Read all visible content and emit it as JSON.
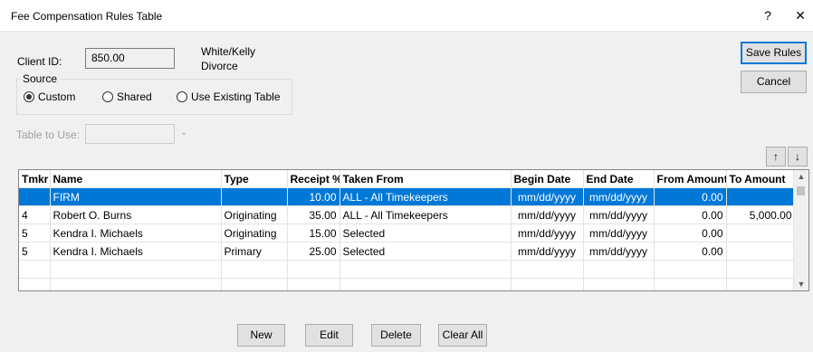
{
  "window": {
    "title": "Fee Compensation Rules Table",
    "help": "?",
    "close": "✕"
  },
  "client": {
    "id_label": "Client ID:",
    "id_value": "850.00",
    "name_line1": "White/Kelly",
    "name_line2": "Divorce"
  },
  "source": {
    "legend": "Source",
    "options": [
      {
        "label": "Custom",
        "selected": true
      },
      {
        "label": "Shared",
        "selected": false
      },
      {
        "label": "Use Existing Table",
        "selected": false
      }
    ]
  },
  "table_to_use": {
    "label": "Table to Use:",
    "value": ""
  },
  "actions": {
    "save_rules": "Save Rules",
    "cancel": "Cancel"
  },
  "move": {
    "up": "↑",
    "down": "↓"
  },
  "grid": {
    "columns": [
      "Tmkr",
      "Name",
      "Type",
      "Receipt %",
      "Taken From",
      "Begin Date",
      "End Date",
      "From Amount",
      "To Amount"
    ],
    "rows": [
      [
        "",
        "FIRM",
        "",
        "10.00",
        "ALL - All Timekeepers",
        "mm/dd/yyyy",
        "mm/dd/yyyy",
        "0.00",
        ""
      ],
      [
        "4",
        "Robert O. Burns",
        "Originating",
        "35.00",
        "ALL - All Timekeepers",
        "mm/dd/yyyy",
        "mm/dd/yyyy",
        "0.00",
        "5,000.00"
      ],
      [
        "5",
        "Kendra I. Michaels",
        "Originating",
        "15.00",
        "Selected",
        "mm/dd/yyyy",
        "mm/dd/yyyy",
        "0.00",
        ""
      ],
      [
        "5",
        "Kendra I. Michaels",
        "Primary",
        "25.00",
        "Selected",
        "mm/dd/yyyy",
        "mm/dd/yyyy",
        "0.00",
        ""
      ],
      [
        "",
        "",
        "",
        "",
        "",
        "",
        "",
        "",
        ""
      ],
      [
        "",
        "",
        "",
        "",
        "",
        "",
        "",
        "",
        ""
      ]
    ],
    "selected_row": 0
  },
  "bottom_buttons": {
    "new": "New",
    "edit": "Edit",
    "delete": "Delete",
    "clear_all": "Clear All"
  },
  "colors": {
    "selection": "#0078d7",
    "default_button_border": "#0078d7"
  }
}
